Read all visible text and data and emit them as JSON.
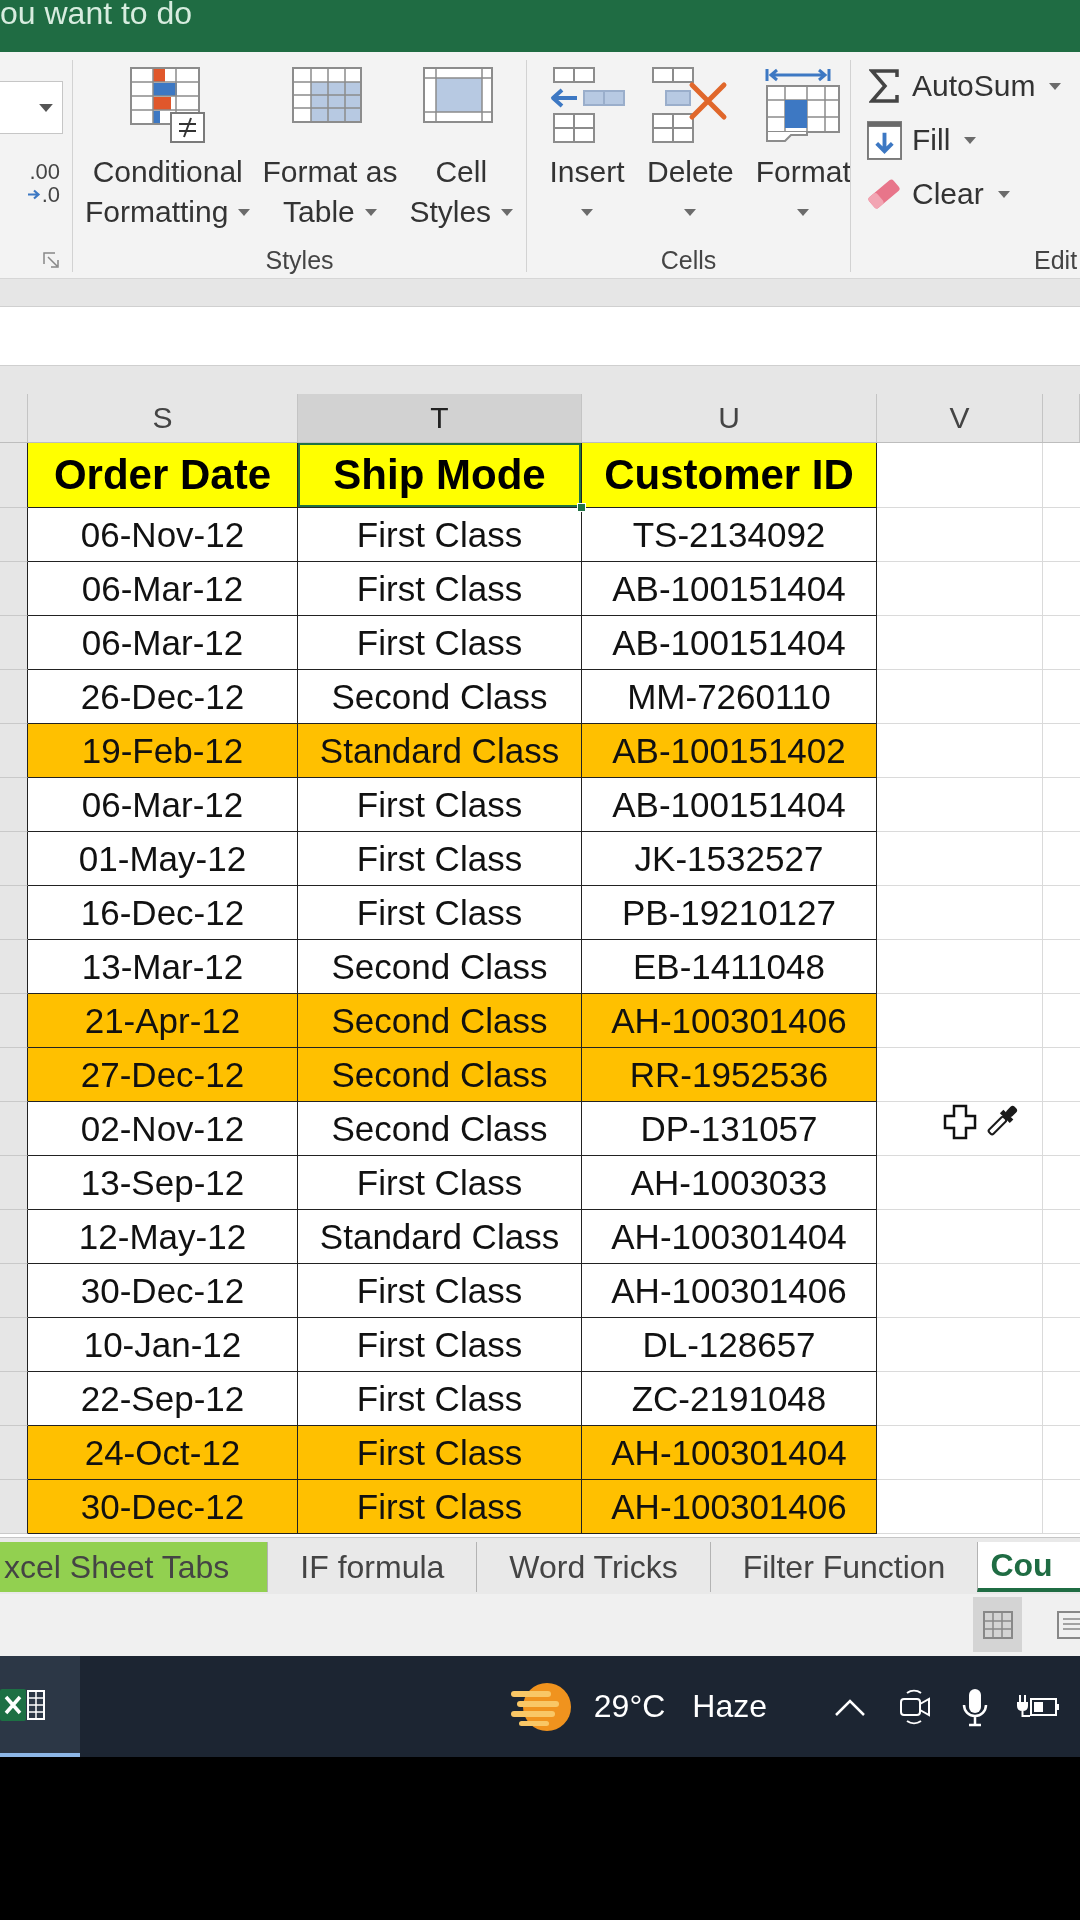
{
  "title_bar": {
    "search_hint": "ou want to do"
  },
  "ribbon": {
    "number": {
      "decimal_top": ".00",
      "decimal_bottom": ".0"
    },
    "styles": {
      "label": "Styles",
      "buttons": [
        {
          "kind": "conditional_formatting",
          "label_lines": [
            "Conditional",
            "Formatting"
          ],
          "dropdown": true
        },
        {
          "kind": "format_as_table",
          "label_lines": [
            "Format as",
            "Table"
          ],
          "dropdown": true
        },
        {
          "kind": "cell_styles",
          "label_lines": [
            "Cell",
            "Styles"
          ],
          "dropdown": true
        }
      ]
    },
    "cells": {
      "label": "Cells",
      "buttons": [
        {
          "kind": "insert",
          "label_lines": [
            "Insert"
          ],
          "dropdown": true
        },
        {
          "kind": "delete",
          "label_lines": [
            "Delete"
          ],
          "dropdown": true
        },
        {
          "kind": "format",
          "label_lines": [
            "Format"
          ],
          "dropdown": true
        }
      ]
    },
    "editing": {
      "label": "Edit",
      "buttons": [
        {
          "kind": "autosum",
          "label": "AutoSum",
          "dropdown": true
        },
        {
          "kind": "fill",
          "label": "Fill",
          "dropdown": true
        },
        {
          "kind": "clear",
          "label": "Clear",
          "dropdown": true
        }
      ]
    }
  },
  "sheet": {
    "columns": [
      {
        "letter": "S",
        "selected": false
      },
      {
        "letter": "T",
        "selected": true
      },
      {
        "letter": "U",
        "selected": false
      },
      {
        "letter": "V",
        "selected": false
      }
    ],
    "headers": [
      {
        "text": "Order Date",
        "selected": false
      },
      {
        "text": "Ship Mode",
        "selected": true
      },
      {
        "text": "Customer ID",
        "selected": false
      }
    ],
    "rows": [
      {
        "cells": [
          "06-Nov-12",
          "First Class",
          "TS-2134092"
        ],
        "highlighted": false
      },
      {
        "cells": [
          "06-Mar-12",
          "First Class",
          "AB-100151404"
        ],
        "highlighted": false
      },
      {
        "cells": [
          "06-Mar-12",
          "First Class",
          "AB-100151404"
        ],
        "highlighted": false
      },
      {
        "cells": [
          "26-Dec-12",
          "Second Class",
          "MM-7260110"
        ],
        "highlighted": false
      },
      {
        "cells": [
          "19-Feb-12",
          "Standard Class",
          "AB-100151402"
        ],
        "highlighted": true
      },
      {
        "cells": [
          "06-Mar-12",
          "First Class",
          "AB-100151404"
        ],
        "highlighted": false
      },
      {
        "cells": [
          "01-May-12",
          "First Class",
          "JK-1532527"
        ],
        "highlighted": false
      },
      {
        "cells": [
          "16-Dec-12",
          "First Class",
          "PB-19210127"
        ],
        "highlighted": false
      },
      {
        "cells": [
          "13-Mar-12",
          "Second Class",
          "EB-1411048"
        ],
        "highlighted": false
      },
      {
        "cells": [
          "21-Apr-12",
          "Second Class",
          "AH-100301406"
        ],
        "highlighted": true
      },
      {
        "cells": [
          "27-Dec-12",
          "Second Class",
          "RR-1952536"
        ],
        "highlighted": true
      },
      {
        "cells": [
          "02-Nov-12",
          "Second Class",
          "DP-131057"
        ],
        "highlighted": false
      },
      {
        "cells": [
          "13-Sep-12",
          "First Class",
          "AH-1003033"
        ],
        "highlighted": false
      },
      {
        "cells": [
          "12-May-12",
          "Standard Class",
          "AH-100301404"
        ],
        "highlighted": false
      },
      {
        "cells": [
          "30-Dec-12",
          "First Class",
          "AH-100301406"
        ],
        "highlighted": false
      },
      {
        "cells": [
          "10-Jan-12",
          "First Class",
          "DL-128657"
        ],
        "highlighted": false
      },
      {
        "cells": [
          "22-Sep-12",
          "First Class",
          "ZC-2191048"
        ],
        "highlighted": false
      },
      {
        "cells": [
          "24-Oct-12",
          "First Class",
          "AH-100301404"
        ],
        "highlighted": true
      },
      {
        "cells": [
          "30-Dec-12",
          "First Class",
          "AH-100301406"
        ],
        "highlighted": true
      }
    ]
  },
  "sheet_tabs": [
    {
      "label": "xcel Sheet Tabs",
      "selected": false,
      "color": "#92d050"
    },
    {
      "label": "IF formula",
      "selected": false
    },
    {
      "label": "Word Tricks",
      "selected": false
    },
    {
      "label": "Filter Function",
      "selected": false
    },
    {
      "label": "Cou",
      "selected": true
    }
  ],
  "status_bar": {
    "view_buttons": [
      {
        "kind": "normal",
        "selected": true
      },
      {
        "kind": "page_layout",
        "selected": false
      }
    ]
  },
  "taskbar": {
    "apps": [
      {
        "kind": "spreadsheet",
        "active": true
      }
    ],
    "weather": {
      "temperature": "29°C",
      "condition": "Haze"
    }
  }
}
